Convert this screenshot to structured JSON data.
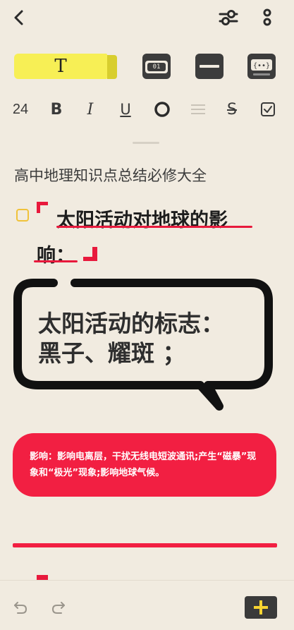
{
  "toolbar": {
    "text_tool_label": "T",
    "counter_label": "01",
    "font_size": "24",
    "bold_label": "B",
    "italic_label": "I",
    "underline_label": "U",
    "strike_label": "S"
  },
  "document": {
    "title": "高中地理知识点总结必修大全",
    "heading_line1": "太阳活动对地球的影",
    "heading_line2": "响：",
    "bubble_line1": "太阳活动的标志：",
    "bubble_line2": "黑子、耀斑 ；",
    "card_text": "影响：影响电离层，干扰无线电短波通讯;产生“磁暴”现象和“极光”现象;影响地球气候。"
  },
  "colors": {
    "accent_red": "#f21f42",
    "highlight_yellow": "#f7ef55",
    "checkbox_yellow": "#f0c23a",
    "background": "#f1ebe0"
  },
  "icons": [
    "back-icon",
    "filter-icon",
    "more-icon",
    "counter-icon",
    "divider-block-icon",
    "code-icon",
    "circle-icon",
    "align-icon",
    "checkbox-icon",
    "undo-icon",
    "redo-icon",
    "plus-icon"
  ]
}
